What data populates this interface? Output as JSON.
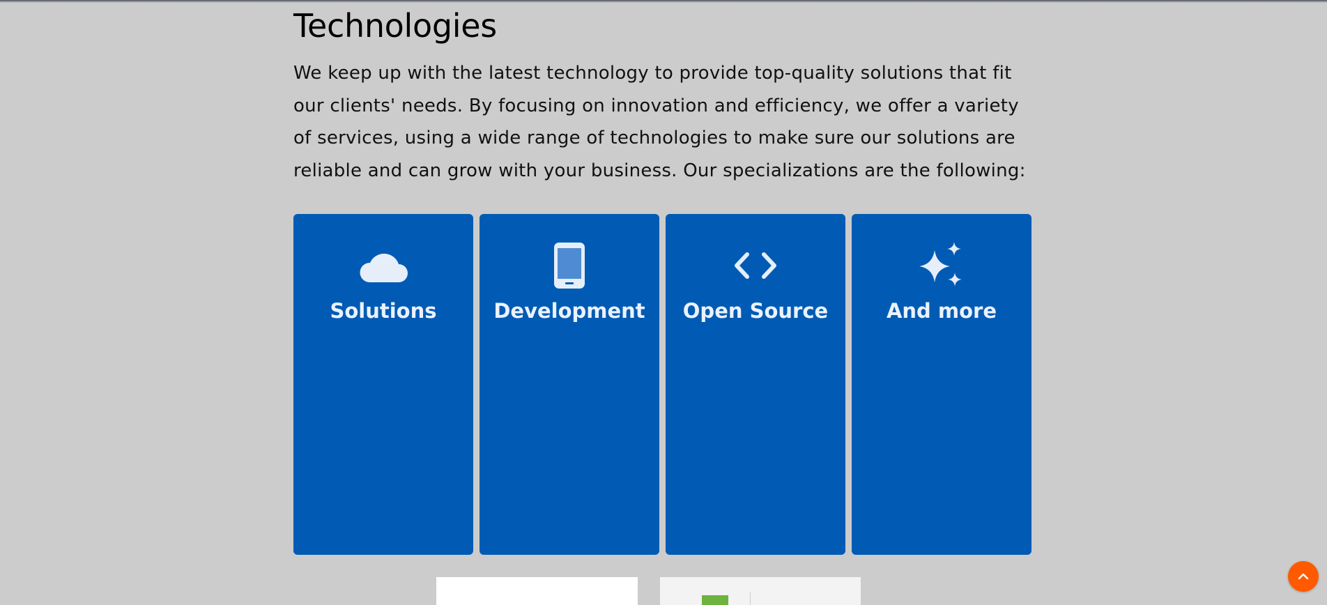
{
  "section": {
    "title": "Technologies",
    "intro": "We keep up with the latest technology to provide top-quality solutions that fit our clients' needs. By focusing on innovation and efficiency, we offer a variety of services, using a wide range of technologies to make sure our solutions are reliable and can grow with your business. Our specializations are the following:"
  },
  "cards": [
    {
      "label": "Solutions",
      "icon": "cloud-icon"
    },
    {
      "label": "Development",
      "icon": "smartphone-icon"
    },
    {
      "label": "Open Source",
      "icon": "code-icon"
    },
    {
      "label": "And more",
      "icon": "sparkles-icon"
    }
  ],
  "scroll_top": {
    "icon": "chevron-up-icon"
  },
  "colors": {
    "page_background": "#cccccc",
    "card_background": "#015bb4",
    "card_text": "#eaf2fc",
    "scroll_top_button": "#ff5a00"
  }
}
